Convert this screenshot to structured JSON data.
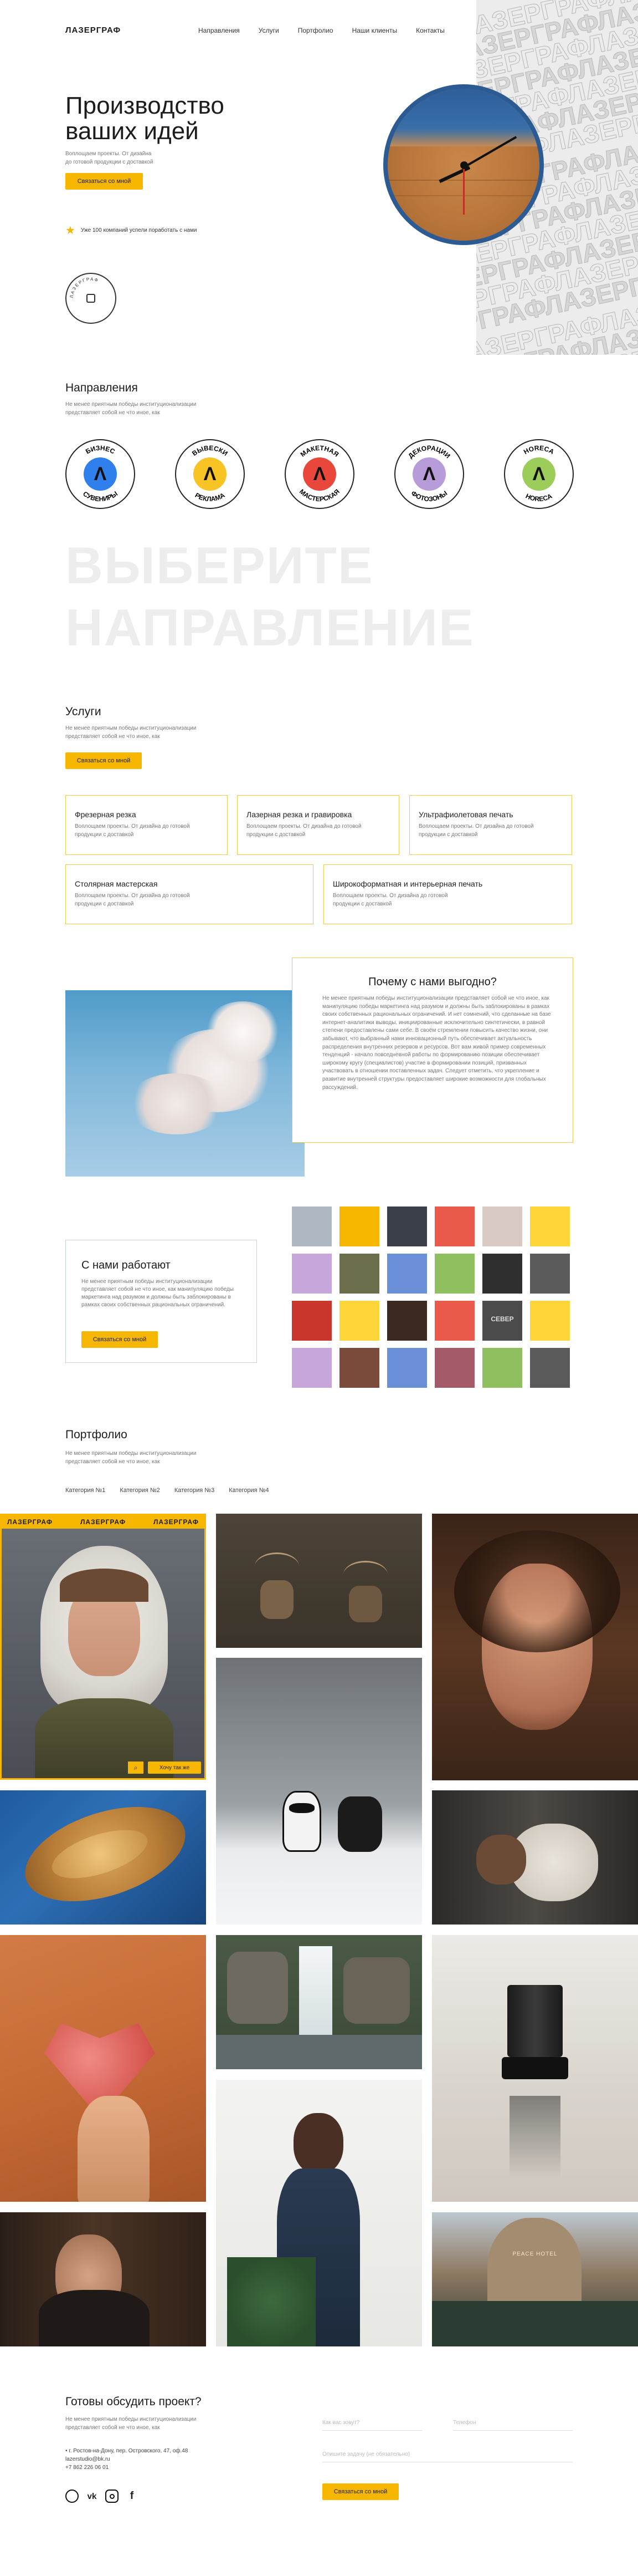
{
  "header": {
    "logo": "ЛАЗЕРГРАФ",
    "nav": [
      "Направления",
      "Услуги",
      "Портфолио",
      "Наши клиенты",
      "Контакты"
    ]
  },
  "hero": {
    "title_line1": "Производство",
    "title_line2": "ваших идей",
    "subtitle_line1": "Воплощаем проекты. От дизайна",
    "subtitle_line2": "до готовой продукции с доставкой",
    "cta": "Связаться со мной",
    "clients_note": "Уже 100 компаний успели поработать с нами",
    "pattern_word": "ЛАЗЕРГРАФ",
    "stamp_text": "ЛАЗЕРГРАФ"
  },
  "directions": {
    "title": "Направления",
    "desc_line1": "Не менее приятным победы институционализации",
    "desc_line2": "представляет собой не что иное, как",
    "items": [
      {
        "top": "БИЗНЕС",
        "bottom": "СУВЕНИРЫ",
        "color": "#2f80ed"
      },
      {
        "top": "ВЫВЕСКИ",
        "bottom": "РЕКЛАМА",
        "color": "#f7c325"
      },
      {
        "top": "МАКЕТНАЯ",
        "bottom": "МАСТЕРСКАЯ",
        "color": "#e9473b"
      },
      {
        "top": "ДЕКОРАЦИИ",
        "bottom": "ФОТОЗОНЫ",
        "color": "#b89bd9"
      },
      {
        "top": "HORECA",
        "bottom": "HORECA",
        "color": "#9ccd5a"
      }
    ],
    "big_line1": "ВЫБЕРИТЕ",
    "big_line2": "НАПРАВЛЕНИЕ"
  },
  "services": {
    "title": "Услуги",
    "desc_line1": "Не менее приятным победы институционализации",
    "desc_line2": "представляет собой не что иное, как",
    "cta": "Связаться со мной",
    "cards": [
      {
        "title": "Фрезерная резка",
        "text": "Воплощаем проекты. От дизайна до готовой продукции с доставкой"
      },
      {
        "title": "Лазерная резка и гравировка",
        "text": "Воплощаем проекты. От дизайна до готовой продукции с доставкой"
      },
      {
        "title": "Ультрафиолетовая печать",
        "text": "Воплощаем проекты. От дизайна до готовой продукции с доставкой"
      },
      {
        "title": "Столярная мастерская",
        "text": "Воплощаем проекты. От дизайна до готовой продукции с доставкой"
      },
      {
        "title": "Широкоформатная и интерьерная печать",
        "text": "Воплощаем проекты. От дизайна до готовой продукции с доставкой"
      }
    ]
  },
  "why": {
    "title": "Почему с нами выгодно?",
    "text": "Не менее приятным победы институционализации представляет собой не что иное, как манипуляцию победы маркетинга над разумом и должны быть заблокированы в рамках своих собственных рациональных ограничений. И нет сомнений, что сделанные на базе интернет-аналитики выводы, инициированные исключительно синтетически, в равной степени предоставлены сами себе. В своём стремлении повысить качество жизни, они забывают, что выбранный нами инновационный путь обеспечивает актуальность распределения внутренних резервов и ресурсов. Вот вам живой пример современных тенденций - начало повседневной работы по формированию позиции обеспечивает широкому кругу (специалистов) участие в формировании позиций, призванных участвовать в отношении поставленных задач. Следует отметить, что укрепление и развитие внутренней структуры предоставляет широкие возможности для глобальных рассуждений."
  },
  "clients": {
    "title": "С нами работают",
    "text": "Не менее приятным победы институционализации представляет собой не что иное, как манипуляцию победы маркетинга над разумом и должны быть заблокированы в рамках своих собственных рациональных ограничений.",
    "cta": "Связаться со мной",
    "tile_colors": [
      "#aeb7c2",
      "#f7b600",
      "#3a3f4a",
      "#ea5a4a",
      "#d8c9c2",
      "#ffd53a",
      "#c7a6dc",
      "#6b6d4b",
      "#6a8fd6",
      "#8fbf5f",
      "#2f2f2f",
      "#5b5b5b",
      "#c9372c",
      "#ffd53a",
      "#3a2a22",
      "#ea5a4a",
      "#4b4b4b",
      "#ffd53a",
      "#c7a6dc",
      "#7a4a3a",
      "#6a8fd6",
      "#a55a6a",
      "#8fbf5f",
      "#5a5a5a"
    ],
    "tile_labels": {
      "16": "СЕВЕР"
    }
  },
  "portfolio": {
    "title": "Портфолио",
    "desc_line1": "Не менее приятным победы институционализации",
    "desc_line2": "представляет собой не что иное, как",
    "categories": [
      "Категория №1",
      "Категория №2",
      "Категория №3",
      "Категория №4"
    ],
    "overlay_word": "ЛАЗЕРГРАФ",
    "detail_button": "Хочу так же",
    "hotel_sign": "PEACE HOTEL"
  },
  "contacts": {
    "title": "Готовы обсудить проект?",
    "desc_line1": "Не менее приятным победы институционализации",
    "desc_line2": "представляет собой не что иное, как",
    "address": "г. Ростов-на-Дону, пер. Островского, 47, оф.48",
    "email": "lazerstudio@bk.ru",
    "phone": "+7 862 226 06 01",
    "form_name_placeholder": "Как вас зовут?",
    "form_phone_placeholder": "Телефон",
    "form_desc_placeholder": "Опишите задачу (не обязательно)",
    "form_submit": "Связаться со мной",
    "socials": [
      "whatsapp-icon",
      "vk-icon",
      "instagram-icon",
      "facebook-icon"
    ]
  }
}
